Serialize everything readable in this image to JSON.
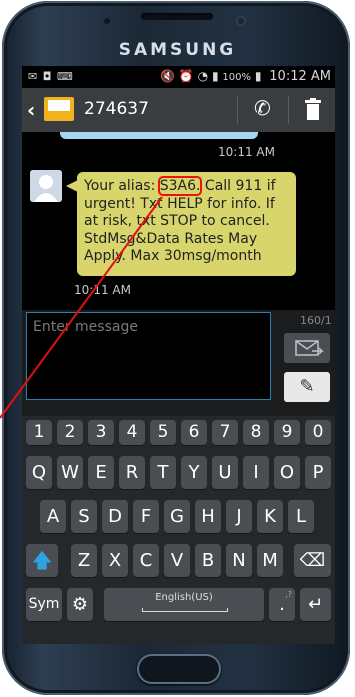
{
  "device": {
    "brand": "SAMSUNG"
  },
  "status_bar": {
    "left_icons": [
      "mail-icon",
      "voicemail-icon",
      "keyboard-icon"
    ],
    "battery": "100%",
    "time": "10:12 AM",
    "icons": [
      "mute-icon",
      "alarm-icon",
      "wifi-icon",
      "signal-icon",
      "battery-icon"
    ]
  },
  "app_bar": {
    "contact": "274637",
    "actions": [
      "phone-icon",
      "delete-icon"
    ]
  },
  "conversation": {
    "previous_timestamp": "10:11 AM",
    "message": {
      "text_before": "Your alias: ",
      "alias": "S3A6.",
      "text_after": " Call 911 if urgent! Txt HELP for info. If at risk, txt STOP to cancel. StdMsg&Data Rates May Apply. Max 30msg/month",
      "timestamp": "10:11 AM"
    }
  },
  "compose": {
    "placeholder": "Enter message",
    "counter": "160/1"
  },
  "keyboard": {
    "number_row": [
      "1",
      "2",
      "3",
      "4",
      "5",
      "6",
      "7",
      "8",
      "9",
      "0"
    ],
    "row1": [
      "Q",
      "W",
      "E",
      "R",
      "T",
      "Y",
      "U",
      "I",
      "O",
      "P"
    ],
    "row2": [
      "A",
      "S",
      "D",
      "F",
      "G",
      "H",
      "J",
      "K",
      "L"
    ],
    "row3": [
      "Z",
      "X",
      "C",
      "V",
      "B",
      "N",
      "M"
    ],
    "sym_label": "Sym",
    "space_label": "English(US)",
    "punct_label": ".",
    "punct_hint": ",?"
  },
  "colors": {
    "accent": "#2b9bd0",
    "bubble": "#d8d56c",
    "highlight": "#e11111"
  }
}
